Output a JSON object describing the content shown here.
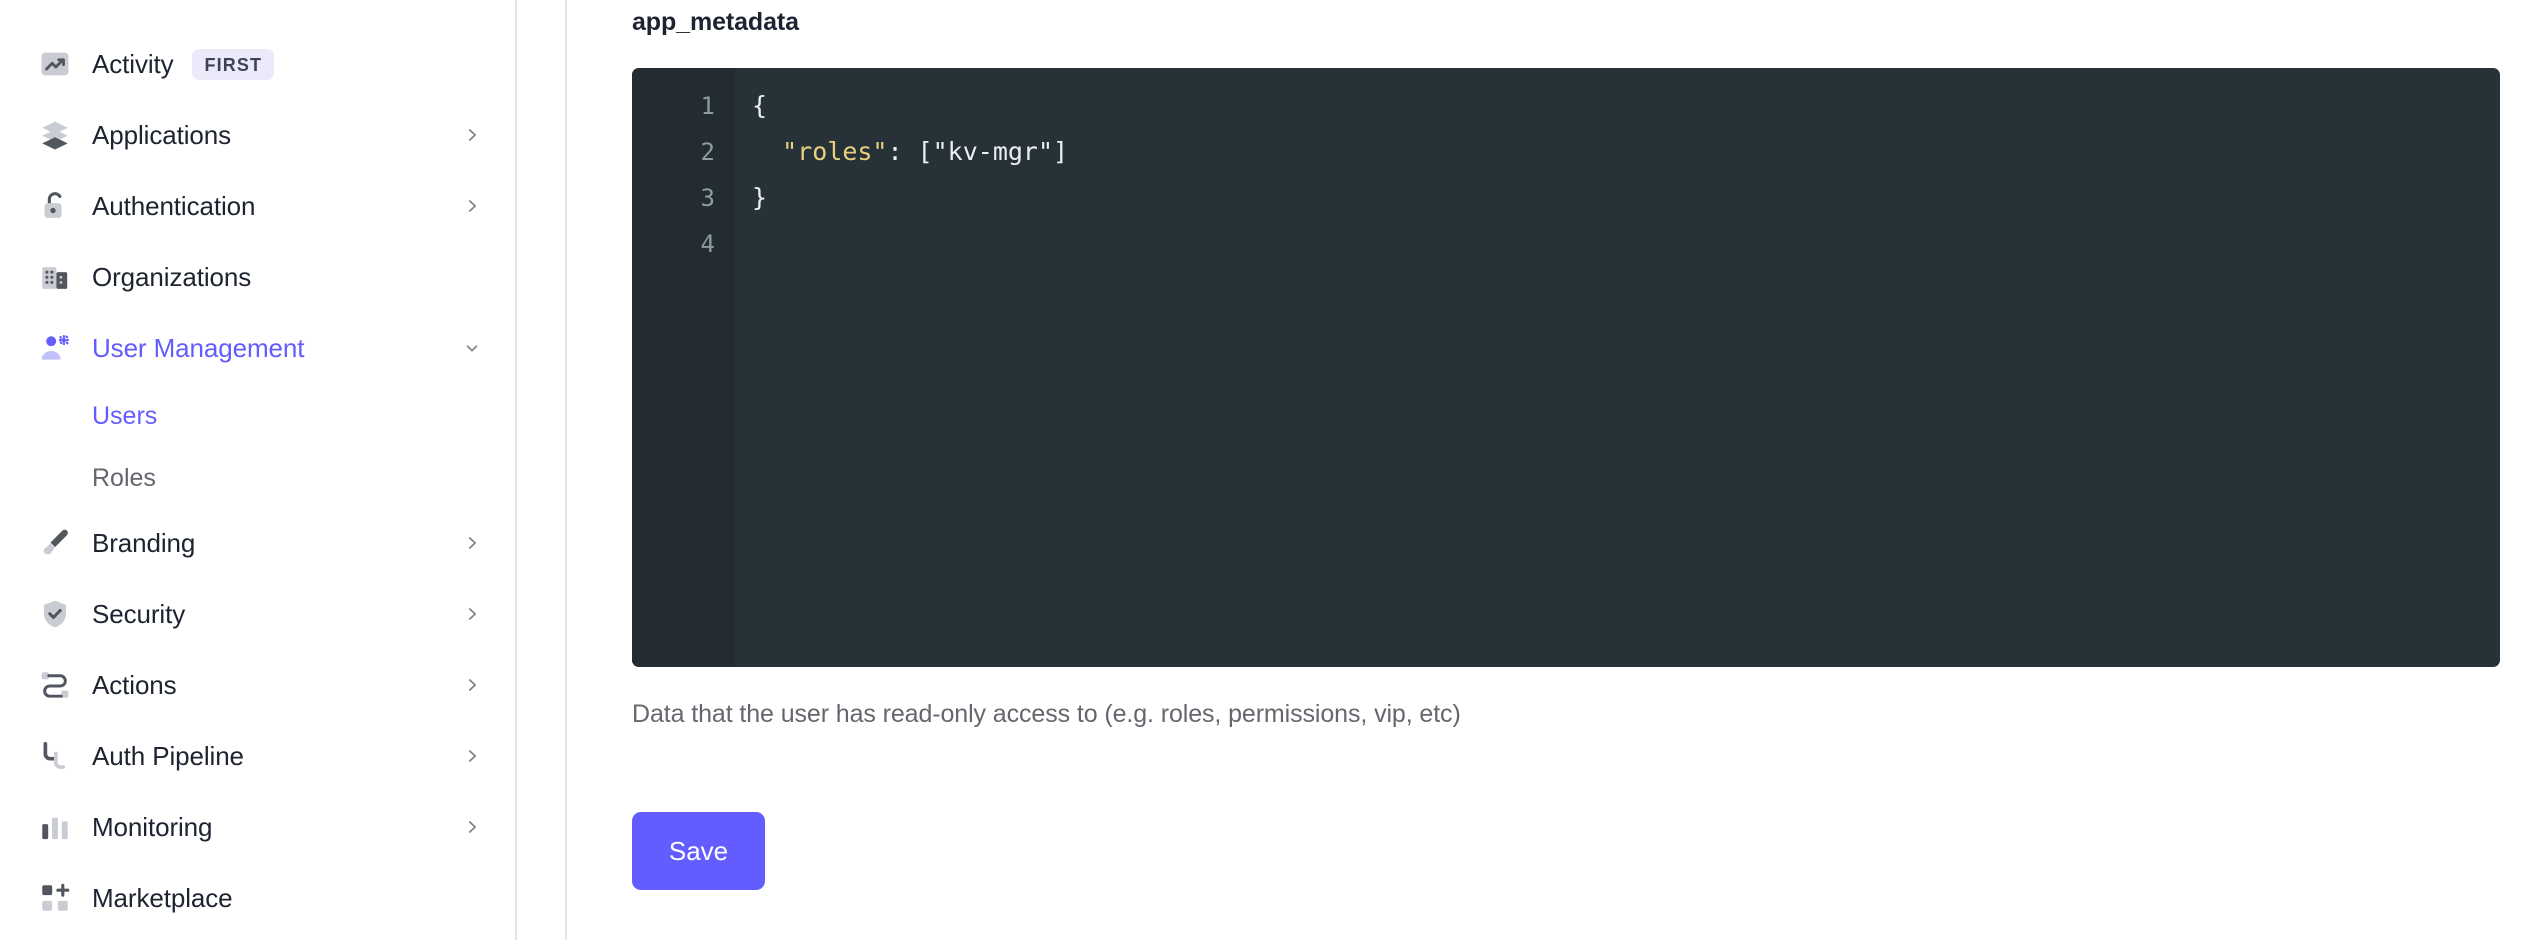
{
  "colors": {
    "accent": "#635dff",
    "sidebar_border": "#e3e4e8",
    "editor_bg": "#263238",
    "editor_gutter_bg": "#232c33",
    "editor_text": "#eceff1",
    "editor_key": "#e8d07f",
    "badge_bg": "#eceafa",
    "badge_text": "#3c4257",
    "muted_text": "#65676e",
    "heading_text": "#1d2330"
  },
  "sidebar": {
    "items": [
      {
        "label": "Activity",
        "icon": "activity-chart-icon",
        "badge": "FIRST",
        "chevron": null,
        "active": false,
        "sub": []
      },
      {
        "label": "Applications",
        "icon": "layers-icon",
        "badge": null,
        "chevron": "right",
        "active": false,
        "sub": []
      },
      {
        "label": "Authentication",
        "icon": "unlocked-padlock-icon",
        "badge": null,
        "chevron": "right",
        "active": false,
        "sub": []
      },
      {
        "label": "Organizations",
        "icon": "building-icon",
        "badge": null,
        "chevron": null,
        "active": false,
        "sub": []
      },
      {
        "label": "User Management",
        "icon": "user-gear-icon",
        "badge": null,
        "chevron": "down",
        "active": true,
        "sub": [
          {
            "label": "Users",
            "active": true
          },
          {
            "label": "Roles",
            "active": false
          }
        ]
      },
      {
        "label": "Branding",
        "icon": "paintbrush-icon",
        "badge": null,
        "chevron": "right",
        "active": false,
        "sub": []
      },
      {
        "label": "Security",
        "icon": "shield-check-icon",
        "badge": null,
        "chevron": "right",
        "active": false,
        "sub": []
      },
      {
        "label": "Actions",
        "icon": "flow-nodes-icon",
        "badge": null,
        "chevron": "right",
        "active": false,
        "sub": []
      },
      {
        "label": "Auth Pipeline",
        "icon": "pipeline-icon",
        "badge": null,
        "chevron": "right",
        "active": false,
        "sub": []
      },
      {
        "label": "Monitoring",
        "icon": "bar-chart-icon",
        "badge": null,
        "chevron": "right",
        "active": false,
        "sub": []
      },
      {
        "label": "Marketplace",
        "icon": "grid-plus-icon",
        "badge": null,
        "chevron": null,
        "active": false,
        "sub": []
      }
    ]
  },
  "main": {
    "field_label": "app_metadata",
    "helper_text": "Data that the user has read-only access to (e.g. roles, permissions, vip, etc)",
    "save_label": "Save",
    "editor": {
      "line_numbers": [
        "1",
        "2",
        "3",
        "4"
      ],
      "lines": [
        [
          {
            "t": "{",
            "c": "tok-punct"
          }
        ],
        [
          {
            "t": "  ",
            "c": "tok-punct"
          },
          {
            "t": "\"roles\"",
            "c": "tok-key"
          },
          {
            "t": ": [\"kv-mgr\"]",
            "c": "tok-punct"
          }
        ],
        [
          {
            "t": "}",
            "c": "tok-punct"
          }
        ],
        [
          {
            "t": "",
            "c": "tok-punct"
          }
        ]
      ],
      "raw_value": "{\n  \"roles\": [\"kv-mgr\"]\n}\n"
    }
  }
}
